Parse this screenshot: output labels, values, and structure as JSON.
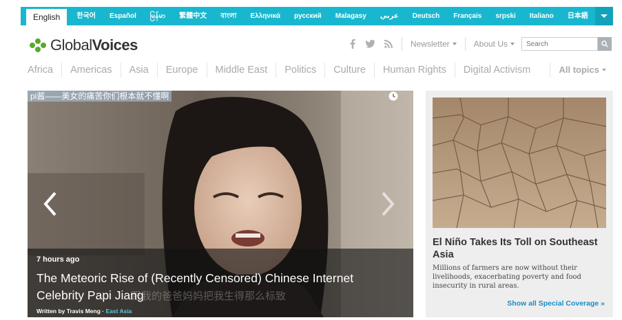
{
  "languages": {
    "active": "English",
    "items": [
      "한국어",
      "Español",
      "မြန်မာ",
      "繁體中文",
      "বাংলা",
      "Ελληνικά",
      "русский",
      "Malagasy",
      "عربي",
      "Deutsch",
      "Français",
      "srpski",
      "Italiano",
      "日本語"
    ]
  },
  "header": {
    "logo_light": "Global",
    "logo_bold": "Voices",
    "newsletter": "Newsletter",
    "about": "About Us",
    "search_placeholder": "Search"
  },
  "topics": [
    "Africa",
    "Americas",
    "Asia",
    "Europe",
    "Middle East",
    "Politics",
    "Culture",
    "Human Rights",
    "Digital Activism"
  ],
  "topics_all": "All topics",
  "hero": {
    "video_caption": "pi酱——美女的痛苦你们根本就不懂啊",
    "subtitle_overlay": "跟我的爸爸妈妈把我生得那么标致",
    "time": "7 hours ago",
    "title": "The Meteoric Rise of (Recently Censored) Chinese Internet Celebrity Papi Jiang",
    "byline_prefix": "Written by Travis Meng · ",
    "byline_tag": "East Asia"
  },
  "sidebar": {
    "title": "El Niño Takes Its Toll on Southeast Asia",
    "text": "Millions of farmers are now without their livelihoods, exacerbating poverty and food insecurity in rural areas.",
    "link": "Show all Special Coverage »"
  },
  "colors": {
    "accent": "#19b7cf",
    "link": "#1a8cc4",
    "logo_green": "#5aa82d"
  }
}
